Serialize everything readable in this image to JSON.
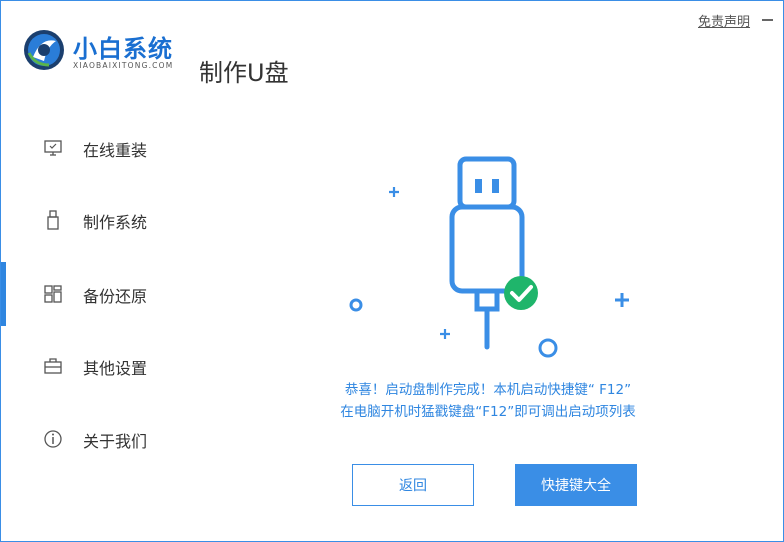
{
  "header": {
    "disclaimer_label": "免责声明",
    "brand_name": "小白系统",
    "brand_domain": "XIAOBAIXITONG.COM",
    "page_title": "制作U盘"
  },
  "sidebar": {
    "items": [
      {
        "label": "在线重装",
        "icon": "monitor-icon",
        "active": false
      },
      {
        "label": "制作系统",
        "icon": "usb-drive-icon",
        "active": false
      },
      {
        "label": "备份还原",
        "icon": "grid-icon",
        "active": true
      },
      {
        "label": "其他设置",
        "icon": "briefcase-icon",
        "active": false
      },
      {
        "label": "关于我们",
        "icon": "info-icon",
        "active": false
      }
    ]
  },
  "main": {
    "message_line1": "恭喜！启动盘制作完成！本机启动快捷键“ F12”",
    "message_line2": "在电脑开机时猛戳键盘“F12”即可调出启动项列表",
    "back_label": "返回",
    "shortcuts_label": "快捷键大全"
  },
  "colors": {
    "accent": "#3a8ee6",
    "success": "#1fb56b",
    "text": "#333333"
  }
}
